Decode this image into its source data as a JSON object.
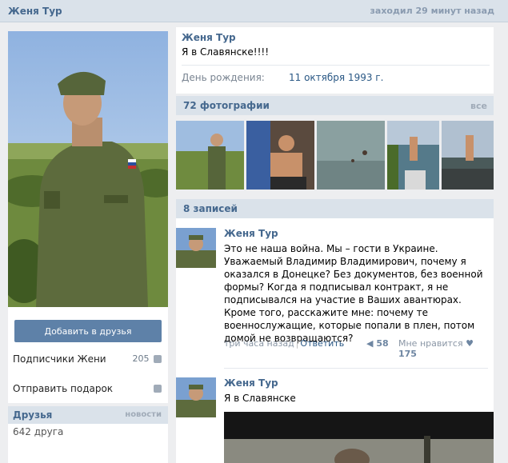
{
  "header": {
    "name": "Женя Тур",
    "last_seen": "заходил 29 минут назад"
  },
  "left": {
    "add_friend_label": "Добавить в друзья",
    "subscribers_label": "Подписчики Жени",
    "subscribers_count": "205",
    "gift_label": "Отправить подарок",
    "friends_title": "Друзья",
    "friends_news_link": "новости",
    "friends_count": "642 друга"
  },
  "profile": {
    "name": "Женя Тур",
    "status": "Я в Славянске!!!!",
    "birthday_label": "День рождения:",
    "birthday_value": "11 октября 1993 г."
  },
  "photos": {
    "title": "72 фотографии",
    "all_link": "все"
  },
  "wall": {
    "title": "8 записей",
    "posts": [
      {
        "author": "Женя Тур",
        "text": "Это не наша война. Мы – гости в Украине. Уважаемый Владимир Владимирович, почему я оказался в Донецке? Без документов, без военной формы? Когда я подписывал контракт, я не подписывался на участие в Ваших авантюрах. Кроме того, расскажите мне: почему те военнослужащие, которые попали в плен, потом домой не возвращаются?",
        "time": "три часа назад",
        "reply": "Ответить",
        "shares": "58",
        "like_label": "Мне нравится",
        "likes": "175"
      },
      {
        "author": "Женя Тур",
        "text": "Я в Славянске"
      }
    ]
  },
  "colors": {
    "link": "#45688e",
    "header_bg": "#dae2ea",
    "button": "#5e81a8",
    "page_bg": "#edeef0"
  }
}
